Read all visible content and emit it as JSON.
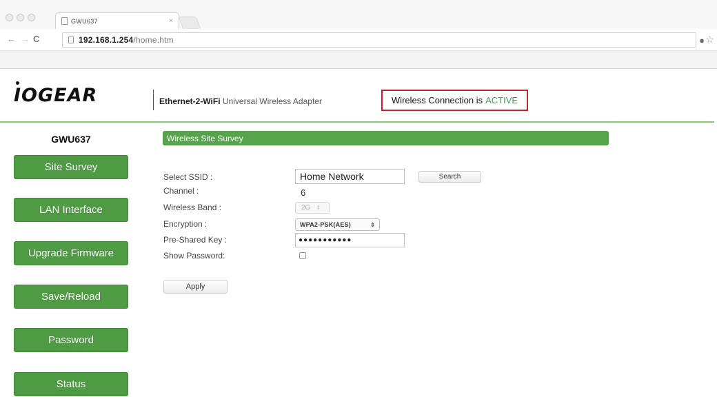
{
  "browser": {
    "tab_title": "GWU637",
    "tab_close": "×",
    "url_host": "192.168.1.254",
    "url_path": "/home.htm",
    "icons": [
      "back-icon",
      "forward-icon",
      "reload-icon",
      "page-icon",
      "bulb-icon",
      "star-icon"
    ]
  },
  "header": {
    "logo": "IOGEAR",
    "product_bold": "Ethernet-2-WiFi",
    "product_rest": " Universal Wireless Adapter",
    "status_prefix": "Wireless Connection is",
    "status_value": "ACTIVE"
  },
  "sidebar": {
    "device_name": "GWU637",
    "items": [
      {
        "label": "Site Survey"
      },
      {
        "label": "LAN Interface"
      },
      {
        "label": "Upgrade Firmware"
      },
      {
        "label": "Save/Reload"
      },
      {
        "label": "Password"
      },
      {
        "label": "Status"
      }
    ]
  },
  "main": {
    "section_title": "Wireless Site Survey",
    "labels": {
      "ssid": "Select SSID :",
      "channel": "Channel :",
      "band": "Wireless Band :",
      "encryption": "Encryption :",
      "psk": "Pre-Shared Key :",
      "show_password": "Show Password:"
    },
    "ssid_value": "Home Network",
    "search_label": "Search",
    "channel_value": "6",
    "band_value": "2G",
    "encryption_value": "WPA2-PSK(AES)",
    "psk_masked": "●●●●●●●●●●●",
    "show_password_checked": false,
    "apply_label": "Apply"
  },
  "colors": {
    "accent_green": "#4f9b44",
    "active_green": "#3fa34d",
    "status_border_red": "#c0262d"
  }
}
